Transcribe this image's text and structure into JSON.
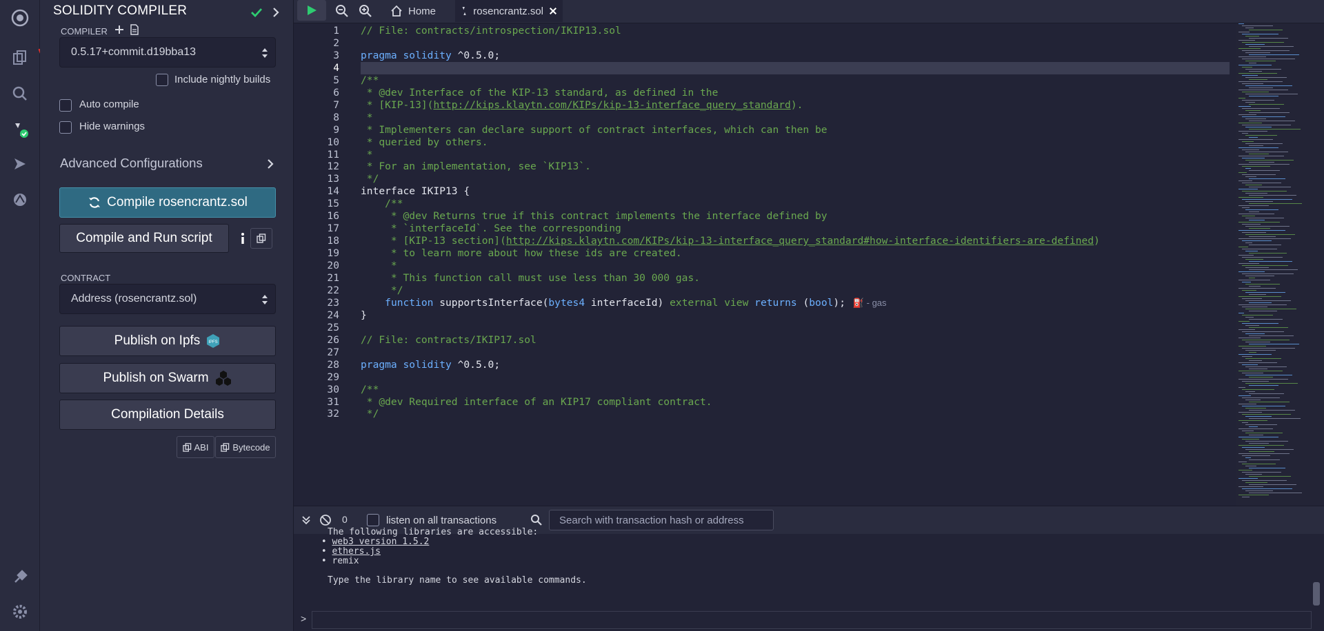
{
  "panel": {
    "title": "SOLIDITY COMPILER",
    "compiler_label": "COMPILER",
    "compiler_version": "0.5.17+commit.d19bba13",
    "include_nightly_label": "Include nightly builds",
    "auto_compile_label": "Auto compile",
    "hide_warnings_label": "Hide warnings",
    "advanced_label": "Advanced Configurations",
    "compile_button": "Compile rosencrantz.sol",
    "compile_run_button": "Compile and Run script",
    "contract_label": "CONTRACT",
    "contract_selected": "Address (rosencrantz.sol)",
    "publish_ipfs": "Publish on Ipfs",
    "publish_swarm": "Publish on Swarm",
    "compilation_details": "Compilation Details",
    "abi_label": "ABI",
    "bytecode_label": "Bytecode",
    "ipfs_badge": "IPFS"
  },
  "tabs": {
    "home": "Home",
    "file": "rosencrantz.sol"
  },
  "editor": {
    "lines": [
      "// File: contracts/introspection/IKIP13.sol",
      "",
      "pragma solidity ^0.5.0;",
      "",
      "/**",
      " * @dev Interface of the KIP-13 standard, as defined in the",
      " * [KIP-13](http://kips.klaytn.com/KIPs/kip-13-interface_query_standard).",
      " *",
      " * Implementers can declare support of contract interfaces, which can then be",
      " * queried by others.",
      " *",
      " * For an implementation, see `KIP13`.",
      " */",
      "interface IKIP13 {",
      "    /**",
      "     * @dev Returns true if this contract implements the interface defined by",
      "     * `interfaceId`. See the corresponding",
      "     * [KIP-13 section](http://kips.klaytn.com/KIPs/kip-13-interface_query_standard#how-interface-identifiers-are-defined)",
      "     * to learn more about how these ids are created.",
      "     *",
      "     * This function call must use less than 30 000 gas.",
      "     */",
      "    function supportsInterface(bytes4 interfaceId) external view returns (bool);",
      "}",
      "",
      "// File: contracts/IKIP17.sol",
      "",
      "pragma solidity ^0.5.0;",
      "",
      "/**",
      " * @dev Required interface of an KIP17 compliant contract.",
      " */"
    ],
    "line_numbers": [
      "1",
      "2",
      "3",
      "4",
      "5",
      "6",
      "7",
      "8",
      "9",
      "10",
      "11",
      "12",
      "13",
      "14",
      "15",
      "16",
      "17",
      "18",
      "19",
      "20",
      "21",
      "22",
      "23",
      "24",
      "25",
      "26",
      "27",
      "28",
      "29",
      "30",
      "31",
      "32"
    ],
    "gas_note": "- gas",
    "highlight_line": 4
  },
  "terminal": {
    "count": "0",
    "listen_label": "listen on all transactions",
    "search_placeholder": "Search with transaction hash or address",
    "lines": [
      "The following libraries are accessible:",
      "web3 version 1.5.2",
      "ethers.js",
      "remix",
      "",
      "Type the library name to see available commands."
    ],
    "prompt": ">"
  },
  "colors": {
    "accent_green": "#2ecc71",
    "compile_button": "#2f6a82",
    "comment_green": "#6aa84f",
    "keyword_blue": "#6cb0ff"
  }
}
